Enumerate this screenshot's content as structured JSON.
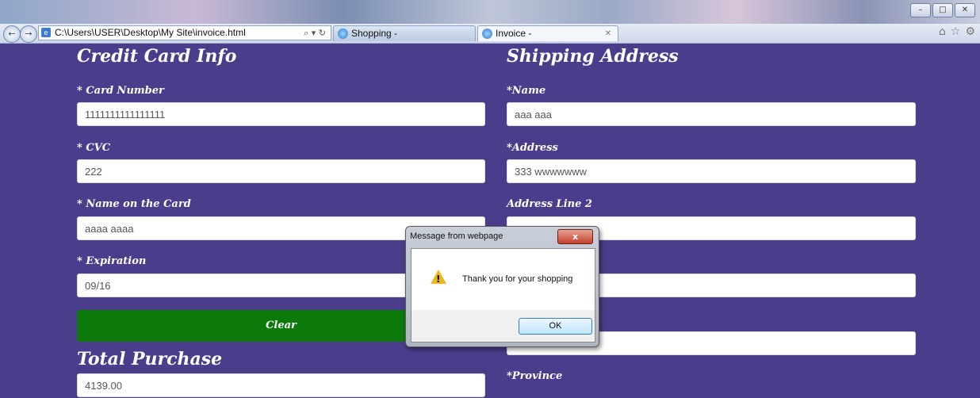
{
  "browser": {
    "address": "C:\\Users\\USER\\Desktop\\My Site\\invoice.html",
    "address_tools": "⌕ ▾ ↻",
    "tabs": [
      {
        "label": "Shopping -"
      },
      {
        "label": "Invoice -"
      }
    ],
    "window_buttons": {
      "minimize": "–",
      "maximize": "□",
      "close": "✕"
    },
    "nav": {
      "back": "←",
      "forward": "→"
    },
    "right_icons": {
      "home": "⌂",
      "favorites": "☆",
      "tools": "⚙"
    }
  },
  "credit_card": {
    "heading": "Credit Card Info",
    "card_number_label": "* Card Number",
    "card_number_value": "1111111111111111",
    "cvc_label": "* CVC",
    "cvc_value": "222",
    "name_label": "* Name on the Card",
    "name_value": "aaaa aaaa",
    "expiration_label": "* Expiration",
    "expiration_value": "09/16",
    "clear_label": "Clear",
    "total_heading": "Total Purchase",
    "total_value": "4139.00"
  },
  "shipping": {
    "heading": "Shipping Address",
    "name_label": "*Name",
    "name_value": "aaa aaa",
    "address_label": "*Address",
    "address_value": "333 wwwwwww",
    "address2_label": "Address Line 2",
    "address2_value": "",
    "field4_value": "",
    "field5_value": "",
    "province_label": "*Province"
  },
  "dialog": {
    "title": "Message from webpage",
    "message": "Thank you for your shopping",
    "ok_label": "OK",
    "close_label": "x",
    "icon": "warning-icon"
  }
}
